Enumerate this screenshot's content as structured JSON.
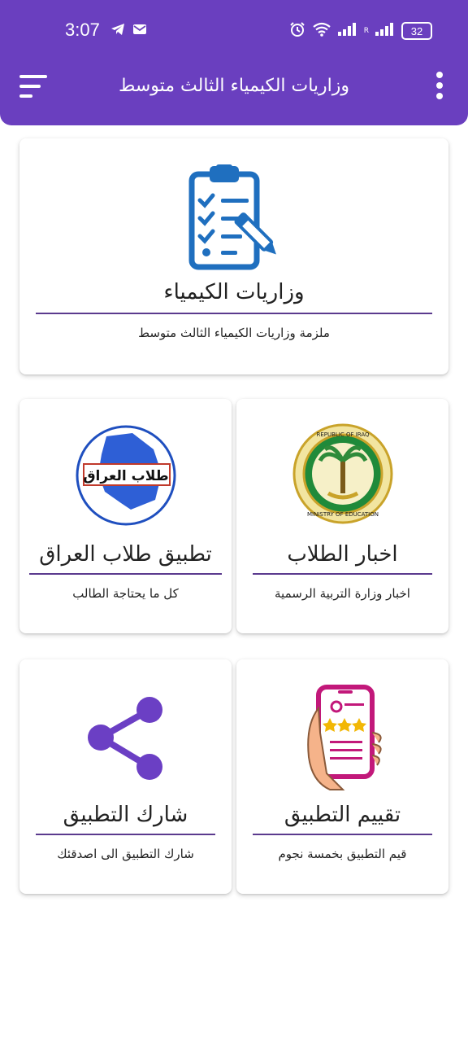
{
  "status_bar": {
    "time": "3:07",
    "battery": "32",
    "signal_label": "R"
  },
  "app_bar": {
    "title": "وزاريات الكيمياء الثالث متوسط",
    "background": "#6a3fbf"
  },
  "cards": {
    "main": {
      "title": "وزاريات الكيمياء",
      "subtitle": "ملزمة وزاريات الكيمياء الثالث متوسط",
      "icon": "clipboard-checklist-icon"
    },
    "news": {
      "title": "اخبار الطلاب",
      "subtitle": "اخبار وزارة التربية الرسمية",
      "icon": "ministry-of-education-seal",
      "seal_text_top": "REPUBLIC OF IRAQ",
      "seal_text_bottom": "MINISTRY OF EDUCATION"
    },
    "students": {
      "title": "تطبيق طلاب العراق",
      "subtitle": "كل ما يحتاجة الطالب",
      "icon": "iraq-students-logo",
      "logo_text": "طلاب العراق"
    },
    "rate": {
      "title": "تقييم التطبيق",
      "subtitle": "قيم التطبيق بخمسة نجوم",
      "icon": "phone-rating-icon"
    },
    "share": {
      "title": "شارك التطبيق",
      "subtitle": "شارك التطبيق الى اصدقئك",
      "icon": "share-icon"
    }
  },
  "colors": {
    "accent": "#6a3fbf",
    "divider": "#5b3a8e",
    "icon_blue": "#1f6fbf",
    "share_purple": "#6b3fc4",
    "phone_magenta": "#c2187a"
  }
}
